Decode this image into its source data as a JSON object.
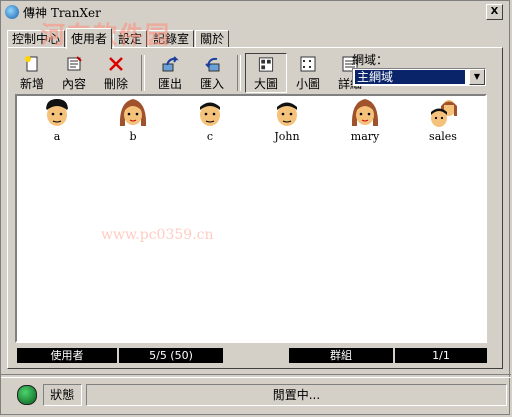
{
  "window": {
    "title": "傳神 TranXer",
    "close_glyph": "X"
  },
  "tabs": [
    "控制中心",
    "使用者",
    "設定",
    "記錄室",
    "關於"
  ],
  "active_tab": 1,
  "toolbar": {
    "new_label": "新增",
    "content_label": "內容",
    "delete_label": "刪除",
    "export_label": "匯出",
    "import_label": "匯入",
    "large_label": "大圖",
    "small_label": "小圖",
    "detail_label": "詳細"
  },
  "network": {
    "label": "網域：",
    "value": "主網域"
  },
  "users": [
    {
      "name": "a",
      "avatar": "male-avatar-icon"
    },
    {
      "name": "b",
      "avatar": "female-avatar-icon"
    },
    {
      "name": "c",
      "avatar": "male-avatar-icon"
    },
    {
      "name": "John",
      "avatar": "male-avatar-icon"
    },
    {
      "name": "mary",
      "avatar": "female-avatar-icon"
    },
    {
      "name": "sales",
      "avatar": "group-avatar-icon"
    }
  ],
  "status_row": {
    "users_label": "使用者",
    "users_count": "5/5 (50)",
    "group_label": "群組",
    "group_count": "1/1"
  },
  "bottom": {
    "state_label": "狀態",
    "state_value": "閒置中..."
  },
  "watermark": {
    "text": "河东软件园",
    "url": "www.pc0359.cn"
  },
  "colors": {
    "selection": "#0a246a",
    "face": "#d4d0c8",
    "led": "#2a9a45"
  }
}
